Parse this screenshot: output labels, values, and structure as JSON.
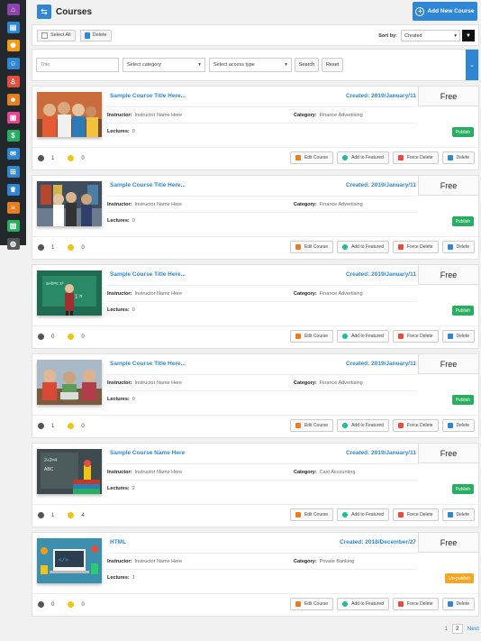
{
  "sidebar": {
    "items": [
      {
        "icon": "home-icon",
        "color": "#8e44ad",
        "glyph": "⌂"
      },
      {
        "icon": "book-icon",
        "color": "#2e86d4",
        "glyph": "▤"
      },
      {
        "icon": "settings-icon",
        "color": "#f39c12",
        "glyph": "✺"
      },
      {
        "icon": "users-icon",
        "color": "#2e86d4",
        "glyph": "☺"
      },
      {
        "icon": "instructor-icon",
        "color": "#e74c3c",
        "glyph": "♙"
      },
      {
        "icon": "group-icon",
        "color": "#e67e22",
        "glyph": "☻"
      },
      {
        "icon": "wallet-icon",
        "color": "#e84393",
        "glyph": "▣"
      },
      {
        "icon": "payments-icon",
        "color": "#27ae60",
        "glyph": "$"
      },
      {
        "icon": "mail-icon",
        "color": "#2e86d4",
        "glyph": "✉"
      },
      {
        "icon": "hierarchy-icon",
        "color": "#2e86d4",
        "glyph": "⊞"
      },
      {
        "icon": "trophy-icon",
        "color": "#2e86d4",
        "glyph": "♛"
      },
      {
        "icon": "reports-icon",
        "color": "#e67e22",
        "glyph": "≡"
      },
      {
        "icon": "store-icon",
        "color": "#27ae60",
        "glyph": "▥"
      },
      {
        "icon": "globe-icon",
        "color": "#555555",
        "glyph": "◍"
      }
    ]
  },
  "header": {
    "title": "Courses",
    "add_button": "Add New Course"
  },
  "toolbar": {
    "select_all": "Select All",
    "delete": "Delete",
    "sort_label": "Sort by:",
    "sort_value": "Created"
  },
  "filters": {
    "title_placeholder": "Title",
    "category": "Select category",
    "access": "Select access type",
    "search": "Search",
    "reset": "Reset"
  },
  "actions": {
    "edit": "Edit Course",
    "featured": "Add to Featured",
    "force_delete": "Force Delete",
    "delete": "Delete"
  },
  "colors": {
    "accent": "#2e86d4",
    "publish": "#27ae60",
    "unpublish": "#f5a623"
  },
  "courses": [
    {
      "title": "Sample Course Title Here...",
      "created": "Created: 2019/January/11",
      "price": "Free",
      "instructor_label": "Instructor:",
      "instructor": "Instructor Name Here",
      "category_label": "Category:",
      "category": "Finance Advertising",
      "lectures_label": "Lectures:",
      "lectures": "0",
      "status": "Publish",
      "status_type": "publish",
      "students": "1",
      "rating": "0"
    },
    {
      "title": "Sample Course Title Here...",
      "created": "Created: 2019/January/11",
      "price": "Free",
      "instructor_label": "Instructor:",
      "instructor": "Instructor Name Here",
      "category_label": "Category:",
      "category": "Finance Advertising",
      "lectures_label": "Lectures:",
      "lectures": "0",
      "status": "Publish",
      "status_type": "publish",
      "students": "1",
      "rating": "0"
    },
    {
      "title": "Sample Course Title Here...",
      "created": "Created: 2019/January/11",
      "price": "Free",
      "instructor_label": "Instructor:",
      "instructor": "Instructor Name Here",
      "category_label": "Category:",
      "category": "Finance Advertising",
      "lectures_label": "Lectures:",
      "lectures": "0",
      "status": "Publish",
      "status_type": "publish",
      "students": "0",
      "rating": "0"
    },
    {
      "title": "Sample Course Title Here...",
      "created": "Created: 2019/January/11",
      "price": "Free",
      "instructor_label": "Instructor:",
      "instructor": "Instructor Name Here",
      "category_label": "Category:",
      "category": "Finance Advertising",
      "lectures_label": "Lectures:",
      "lectures": "0",
      "status": "Publish",
      "status_type": "publish",
      "students": "1",
      "rating": "0"
    },
    {
      "title": "Sample Course Name Here",
      "created": "Created: 2019/January/11",
      "price": "Free",
      "instructor_label": "Instructor:",
      "instructor": "Instructor Name Here",
      "category_label": "Category:",
      "category": "Cast Accounting",
      "lectures_label": "Lectures:",
      "lectures": "2",
      "status": "Publish",
      "status_type": "publish",
      "students": "1",
      "rating": "4"
    },
    {
      "title": "HTML",
      "created": "Created: 2018/December/27",
      "price": "Free",
      "instructor_label": "Instructor:",
      "instructor": "Instructor Name Here",
      "category_label": "Category:",
      "category": "Private Banking",
      "lectures_label": "Lectures:",
      "lectures": "1",
      "status": "Un-publish",
      "status_type": "unpublish",
      "students": "0",
      "rating": "0"
    }
  ],
  "pagination": {
    "pages": [
      "1",
      "2"
    ],
    "active": "2",
    "next": "Next"
  }
}
